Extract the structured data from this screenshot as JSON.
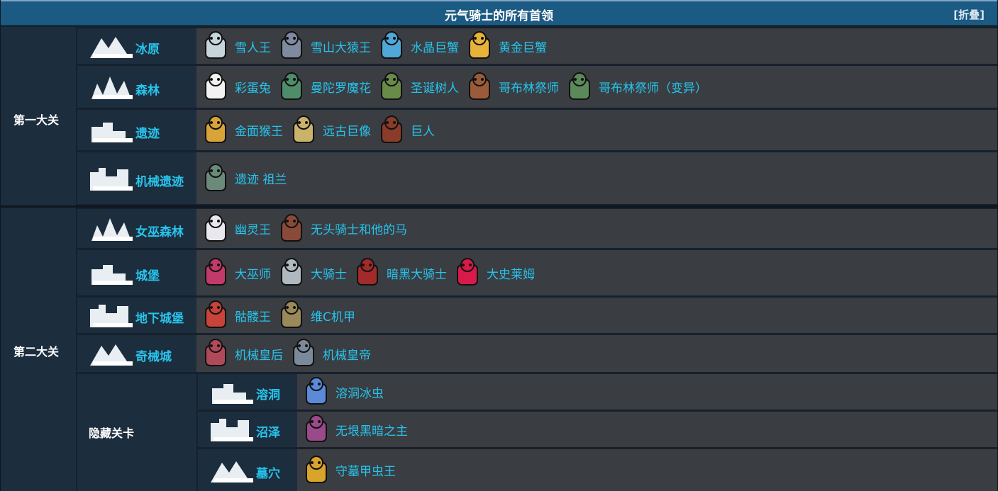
{
  "header": {
    "title": "元气骑士的所有首领",
    "toggle": "折叠"
  },
  "groups": [
    {
      "label": "第一大关",
      "rows": [
        {
          "title": "冰原",
          "bosses": [
            {
              "name": "雪人王",
              "color": "#c8d4dc"
            },
            {
              "name": "雪山大猿王",
              "color": "#7f8aa0"
            },
            {
              "name": "水晶巨蟹",
              "color": "#4fa8d8"
            },
            {
              "name": "黄金巨蟹",
              "color": "#e6b23a"
            }
          ]
        },
        {
          "title": "森林",
          "bosses": [
            {
              "name": "彩蛋兔",
              "color": "#f2f2f2"
            },
            {
              "name": "曼陀罗魔花",
              "color": "#4f8c6a"
            },
            {
              "name": "圣诞树人",
              "color": "#6a8a4a"
            },
            {
              "name": "哥布林祭师",
              "color": "#9a5b3a"
            },
            {
              "name": "哥布林祭师（变异）",
              "color": "#5b8a5a"
            }
          ]
        },
        {
          "title": "遗迹",
          "bosses": [
            {
              "name": "金面猴王",
              "color": "#d8a43a"
            },
            {
              "name": "远古巨像",
              "color": "#c9b36a"
            },
            {
              "name": "巨人",
              "color": "#8a3b2a"
            }
          ]
        },
        {
          "title": "机械遗迹",
          "bosses": [
            {
              "name": "遗迹 祖兰",
              "color": "#6a8a7a"
            }
          ]
        }
      ]
    },
    {
      "label": "第二大关",
      "rows": [
        {
          "title": "女巫森林",
          "bosses": [
            {
              "name": "幽灵王",
              "color": "#e8e8ee"
            },
            {
              "name": "无头骑士和他的马",
              "color": "#8a4a3a"
            }
          ]
        },
        {
          "title": "城堡",
          "bosses": [
            {
              "name": "大巫师",
              "color": "#c23a6a"
            },
            {
              "name": "大骑士",
              "color": "#b0b8c0"
            },
            {
              "name": "暗黑大骑士",
              "color": "#a32a2a"
            },
            {
              "name": "大史莱姆",
              "color": "#d81a4a"
            }
          ]
        },
        {
          "title": "地下城堡",
          "bosses": [
            {
              "name": "骷髅王",
              "color": "#c8433a"
            },
            {
              "name": "维C机甲",
              "color": "#9a8a5a"
            }
          ]
        },
        {
          "title": "奇械城",
          "bosses": [
            {
              "name": "机械皇后",
              "color": "#b04a5a"
            },
            {
              "name": "机械皇帝",
              "color": "#7a8a9a"
            }
          ]
        }
      ],
      "hidden": {
        "label": "隐藏关卡",
        "rows": [
          {
            "title": "溶洞",
            "bosses": [
              {
                "name": "溶洞冰虫",
                "color": "#5a8ad8"
              }
            ]
          },
          {
            "title": "沼泽",
            "bosses": [
              {
                "name": "无垠黑暗之主",
                "color": "#9a4a8a"
              }
            ]
          },
          {
            "title": "墓穴",
            "bosses": [
              {
                "name": "守墓甲虫王",
                "color": "#d8a42a"
              }
            ]
          }
        ]
      }
    }
  ]
}
